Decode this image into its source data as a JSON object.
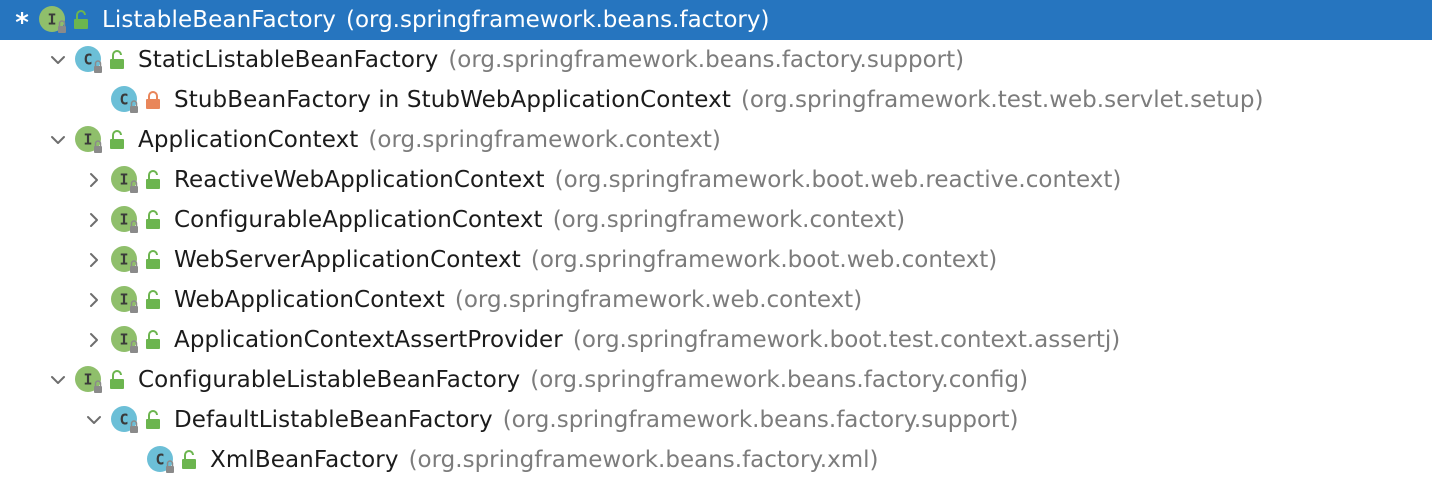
{
  "tree": {
    "rows": [
      {
        "kind": "interface",
        "visibility": "public",
        "toggle": "star",
        "toggle_text": "*",
        "depth": 0,
        "selected": true,
        "name": "ListableBeanFactory",
        "package": "(org.springframework.beans.factory)"
      },
      {
        "kind": "class",
        "visibility": "public",
        "toggle": "expanded",
        "depth": 1,
        "selected": false,
        "name": "StaticListableBeanFactory",
        "package": "(org.springframework.beans.factory.support)"
      },
      {
        "kind": "class",
        "visibility": "private",
        "toggle": "none",
        "depth": 2,
        "selected": false,
        "name": "StubBeanFactory in StubWebApplicationContext",
        "package": "(org.springframework.test.web.servlet.setup)"
      },
      {
        "kind": "interface",
        "visibility": "public",
        "toggle": "expanded",
        "depth": 1,
        "selected": false,
        "name": "ApplicationContext",
        "package": "(org.springframework.context)"
      },
      {
        "kind": "interface",
        "visibility": "public",
        "toggle": "collapsed",
        "depth": 2,
        "selected": false,
        "name": "ReactiveWebApplicationContext",
        "package": "(org.springframework.boot.web.reactive.context)"
      },
      {
        "kind": "interface",
        "visibility": "public",
        "toggle": "collapsed",
        "depth": 2,
        "selected": false,
        "name": "ConfigurableApplicationContext",
        "package": "(org.springframework.context)"
      },
      {
        "kind": "interface",
        "visibility": "public",
        "toggle": "collapsed",
        "depth": 2,
        "selected": false,
        "name": "WebServerApplicationContext",
        "package": "(org.springframework.boot.web.context)"
      },
      {
        "kind": "interface",
        "visibility": "public",
        "toggle": "collapsed",
        "depth": 2,
        "selected": false,
        "name": "WebApplicationContext",
        "package": "(org.springframework.web.context)"
      },
      {
        "kind": "interface",
        "visibility": "public",
        "toggle": "collapsed",
        "depth": 2,
        "selected": false,
        "name": "ApplicationContextAssertProvider",
        "package": "(org.springframework.boot.test.context.assertj)"
      },
      {
        "kind": "interface",
        "visibility": "public",
        "toggle": "expanded",
        "depth": 1,
        "selected": false,
        "name": "ConfigurableListableBeanFactory",
        "package": "(org.springframework.beans.factory.config)"
      },
      {
        "kind": "class",
        "visibility": "public",
        "toggle": "expanded",
        "depth": 2,
        "selected": false,
        "name": "DefaultListableBeanFactory",
        "package": "(org.springframework.beans.factory.support)"
      },
      {
        "kind": "class",
        "visibility": "public",
        "toggle": "none",
        "depth": 3,
        "selected": false,
        "name": "XmlBeanFactory",
        "package": "(org.springframework.beans.factory.xml)"
      }
    ]
  },
  "colors": {
    "selection": "#2675bf",
    "interface_icon": "#8fbf6b",
    "class_icon": "#6cbfd7",
    "public_lock": "#6cb54f",
    "private_lock": "#e9865a"
  }
}
